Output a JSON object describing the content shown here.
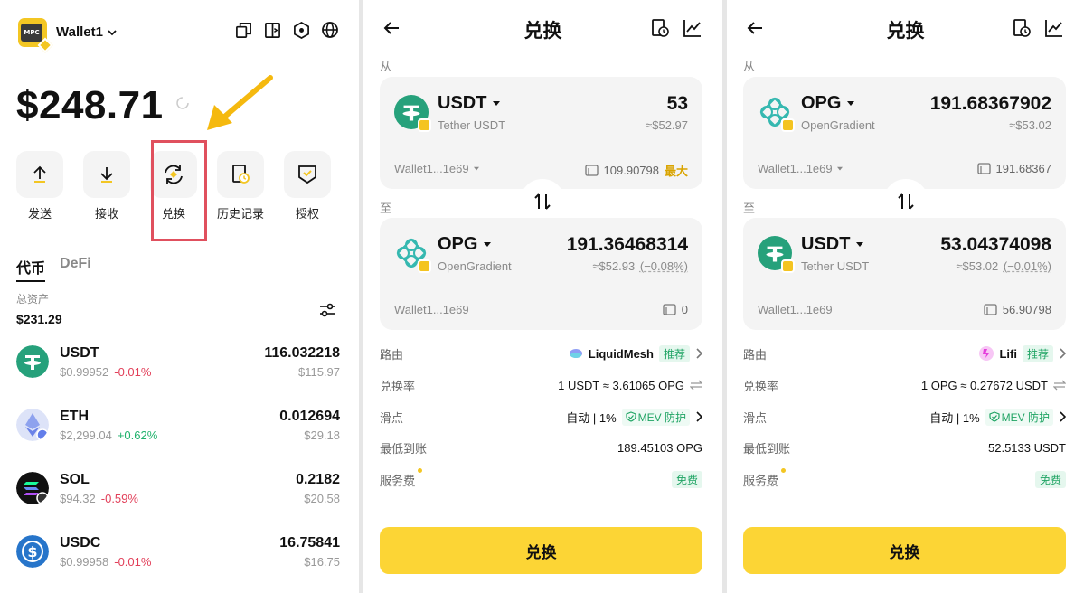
{
  "wallet": {
    "name": "Wallet1",
    "logo_text": "MPC",
    "balance": "$248.71",
    "actions": [
      {
        "label": "发送",
        "icon": "send-icon"
      },
      {
        "label": "接收",
        "icon": "receive-icon"
      },
      {
        "label": "兑换",
        "icon": "swap-icon"
      },
      {
        "label": "历史记录",
        "icon": "history-icon"
      },
      {
        "label": "授权",
        "icon": "authorize-icon"
      }
    ],
    "tabs": [
      "代币",
      "DeFi"
    ],
    "assets_label": "总资产",
    "assets_total": "$231.29",
    "tokens": [
      {
        "symbol": "USDT",
        "price": "$0.99952",
        "change": "-0.01%",
        "amount": "116.032218",
        "usd": "$115.97",
        "color": "#26a17b"
      },
      {
        "symbol": "ETH",
        "price": "$2,299.04",
        "change": "+0.62%",
        "amount": "0.012694",
        "usd": "$29.18",
        "color": "#627eea"
      },
      {
        "symbol": "SOL",
        "price": "$94.32",
        "change": "-0.59%",
        "amount": "0.2182",
        "usd": "$20.58",
        "color": "#111111"
      },
      {
        "symbol": "USDC",
        "price": "$0.99958",
        "change": "-0.01%",
        "amount": "16.75841",
        "usd": "$16.75",
        "color": "#2775ca"
      }
    ]
  },
  "swap1": {
    "title": "兑换",
    "from_label": "从",
    "to_label": "至",
    "from": {
      "symbol": "USDT",
      "name": "Tether USDT",
      "amount": "53",
      "usd": "≈$52.97",
      "wallet": "Wallet1...1e69",
      "balance": "109.90798",
      "max": "最大"
    },
    "to": {
      "symbol": "OPG",
      "name": "OpenGradient",
      "amount": "191.36468314",
      "usd": "≈$52.93",
      "pct": "(−0.08%)",
      "wallet": "Wallet1...1e69",
      "balance": "0"
    },
    "route_label": "路由",
    "route": "LiquidMesh",
    "recommend": "推荐",
    "rate_label": "兑换率",
    "rate": "1 USDT ≈ 3.61065 OPG",
    "slippage_label": "滑点",
    "slippage": "自动 | 1%",
    "mev": "MEV 防护",
    "min_label": "最低到账",
    "min": "189.45103 OPG",
    "fee_label": "服务费",
    "fee": "免费",
    "button": "兑换"
  },
  "swap2": {
    "title": "兑换",
    "from_label": "从",
    "to_label": "至",
    "from": {
      "symbol": "OPG",
      "name": "OpenGradient",
      "amount": "191.68367902",
      "usd": "≈$53.02",
      "wallet": "Wallet1...1e69",
      "balance": "191.68367"
    },
    "to": {
      "symbol": "USDT",
      "name": "Tether USDT",
      "amount": "53.04374098",
      "usd": "≈$53.02",
      "pct": "(−0.01%)",
      "wallet": "Wallet1...1e69",
      "balance": "56.90798"
    },
    "route_label": "路由",
    "route": "Lifi",
    "recommend": "推荐",
    "rate_label": "兑换率",
    "rate": "1 OPG ≈ 0.27672 USDT",
    "slippage_label": "滑点",
    "slippage": "自动 | 1%",
    "mev": "MEV 防护",
    "min_label": "最低到账",
    "min": "52.5133 USDT",
    "fee_label": "服务费",
    "fee": "免费",
    "button": "兑换"
  }
}
